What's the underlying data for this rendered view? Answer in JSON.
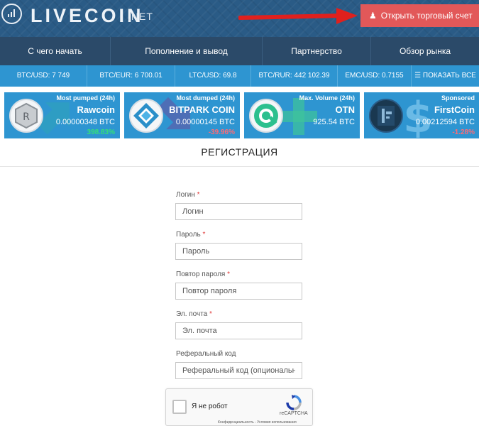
{
  "header": {
    "logo_text": "LIVECOIN",
    "logo_suffix": ".NET",
    "open_account_label": "Открыть торговый счет",
    "open_account_color": "#e25859",
    "background": "#2a5b86"
  },
  "nav": {
    "items": [
      "С чего начать",
      "Пополнение и вывод",
      "Партнерство",
      "Обзор рынка"
    ]
  },
  "ticker": {
    "items": [
      "BTC/USD: 7 749",
      "BTC/EUR: 6 700.01",
      "LTC/USD: 69.8",
      "BTC/RUR: 442 102.39",
      "EMC/USD: 0.7155"
    ],
    "show_all": "☰ ПОКАЗАТЬ ВСЕ"
  },
  "cards": [
    {
      "title": "Most pumped (24h)",
      "name": "Rawcoin",
      "price": "0.00000348 BTC",
      "change": "398.83%",
      "direction": "up",
      "icon": "rawcoin-logo",
      "watermark_icon": "up-arrow-icon"
    },
    {
      "title": "Most dumped (24h)",
      "name": "BITPARK COIN",
      "price": "0.00000145 BTC",
      "change": "-39.96%",
      "direction": "down",
      "icon": "bitpark-logo",
      "watermark_icon": "down-arrow-icon"
    },
    {
      "title": "Max. Volume (24h)",
      "name": "OTN",
      "price": "925.54 BTC",
      "change": "",
      "direction": "none",
      "icon": "otn-logo",
      "watermark_icon": "plus-icon"
    },
    {
      "title": "Sponsored",
      "name": "FirstCoin",
      "price": "0.00212594 BTC",
      "change": "-1.28%",
      "direction": "down",
      "icon": "firstcoin-logo",
      "watermark_icon": "dollar-icon"
    }
  ],
  "page": {
    "title": "РЕГИСТРАЦИЯ"
  },
  "form": {
    "login": {
      "label": "Логин",
      "placeholder": "Логин",
      "required": "*"
    },
    "password": {
      "label": "Пароль",
      "placeholder": "Пароль",
      "required": "*"
    },
    "password_repeat": {
      "label": "Повтор пароля",
      "placeholder": "Повтор пароля",
      "required": "*"
    },
    "email": {
      "label": "Эл. почта",
      "placeholder": "Эл. почта",
      "required": "*"
    },
    "referral": {
      "label": "Реферальный код",
      "placeholder": "Реферальный код (опциональный)"
    }
  },
  "captcha": {
    "label": "Я не робот",
    "brand": "reCAPTCHA",
    "terms": "Конфиденциальность - Условия использования"
  }
}
